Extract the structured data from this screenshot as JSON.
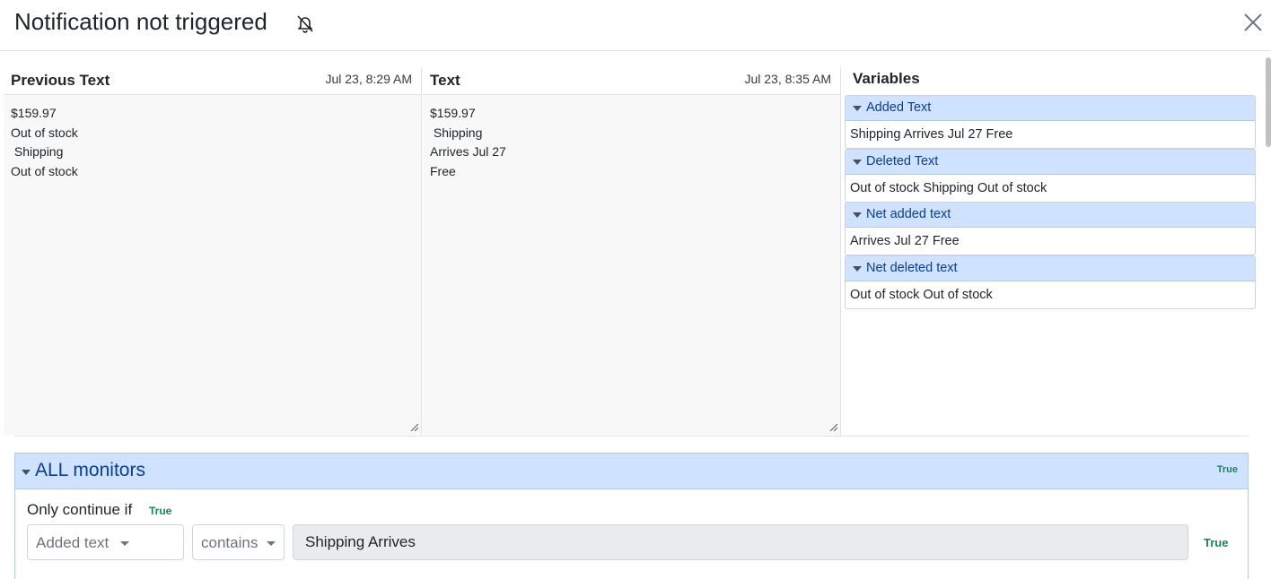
{
  "dialog": {
    "title": "Notification not triggered",
    "bell_icon": "bell-slash-icon",
    "close_icon": "close-icon"
  },
  "previous": {
    "title": "Previous Text",
    "time": "Jul 23, 8:29 AM",
    "content": "$159.97\nOut of stock\n Shipping\nOut of stock"
  },
  "current": {
    "title": "Text",
    "time": "Jul 23, 8:35 AM",
    "content": "$159.97\n Shipping\nArrives Jul 27\nFree"
  },
  "variables": {
    "title": "Variables",
    "items": [
      {
        "label": "Added Text",
        "value": "Shipping Arrives Jul 27 Free"
      },
      {
        "label": "Deleted Text",
        "value": "Out of stock Shipping Out of stock"
      },
      {
        "label": "Net added text",
        "value": "Arrives Jul 27 Free"
      },
      {
        "label": "Net deleted text",
        "value": "Out of stock Out of stock"
      }
    ]
  },
  "monitors": {
    "title": "ALL monitors",
    "status": "True",
    "continue_label": "Only continue if",
    "continue_status": "True",
    "condition": {
      "field": "Added text",
      "operator": "contains",
      "value": "Shipping Arrives",
      "status": "True"
    }
  },
  "colors": {
    "accent_bg": "#cfe2ff",
    "accent_text": "#0b3d91",
    "true_green": "#198754"
  }
}
